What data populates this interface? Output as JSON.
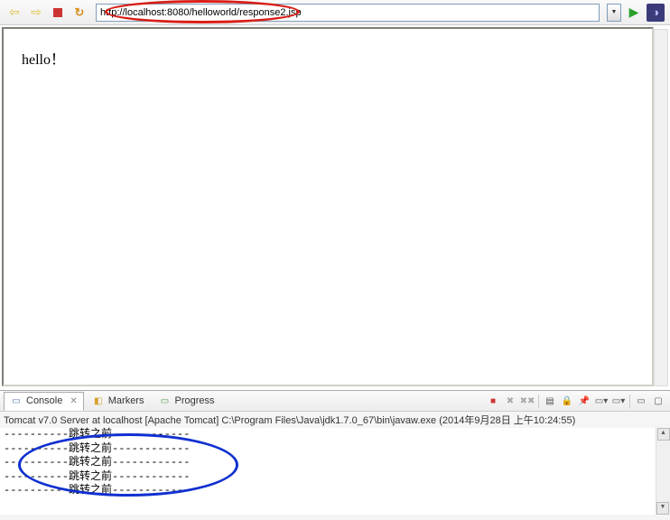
{
  "toolbar": {
    "url": "http://localhost:8080/helloworld/response2.jsp",
    "back_icon": "back-arrow-icon",
    "forward_icon": "forward-arrow-icon",
    "stop_icon": "stop-icon",
    "refresh_icon": "refresh-icon",
    "dropdown_icon": "dropdown-icon",
    "go_icon": "go-icon",
    "app_icon": "eclipse-icon"
  },
  "page": {
    "text": "hello！"
  },
  "tabs": {
    "console": {
      "label": "Console",
      "active": true
    },
    "markers": {
      "label": "Markers",
      "active": false
    },
    "progress": {
      "label": "Progress",
      "active": false
    }
  },
  "console_toolbar": {
    "icons": [
      "stop",
      "remove-launch",
      "remove-all",
      "clear",
      "scroll-lock",
      "pin",
      "display",
      "open",
      "minimize",
      "maximize"
    ]
  },
  "status": {
    "server": "Tomcat v7.0 Server at localhost",
    "bracket": "[Apache Tomcat]",
    "path": "C:\\Program Files\\Java\\jdk1.7.0_67\\bin\\javaw.exe",
    "timestamp": "(2014年9月28日 上午10:24:55)"
  },
  "console": {
    "lines": [
      "----------跳转之前------------",
      "----------跳转之前------------",
      "----------跳转之前------------",
      "----------跳转之前------------",
      "----------跳转之前------------"
    ]
  }
}
